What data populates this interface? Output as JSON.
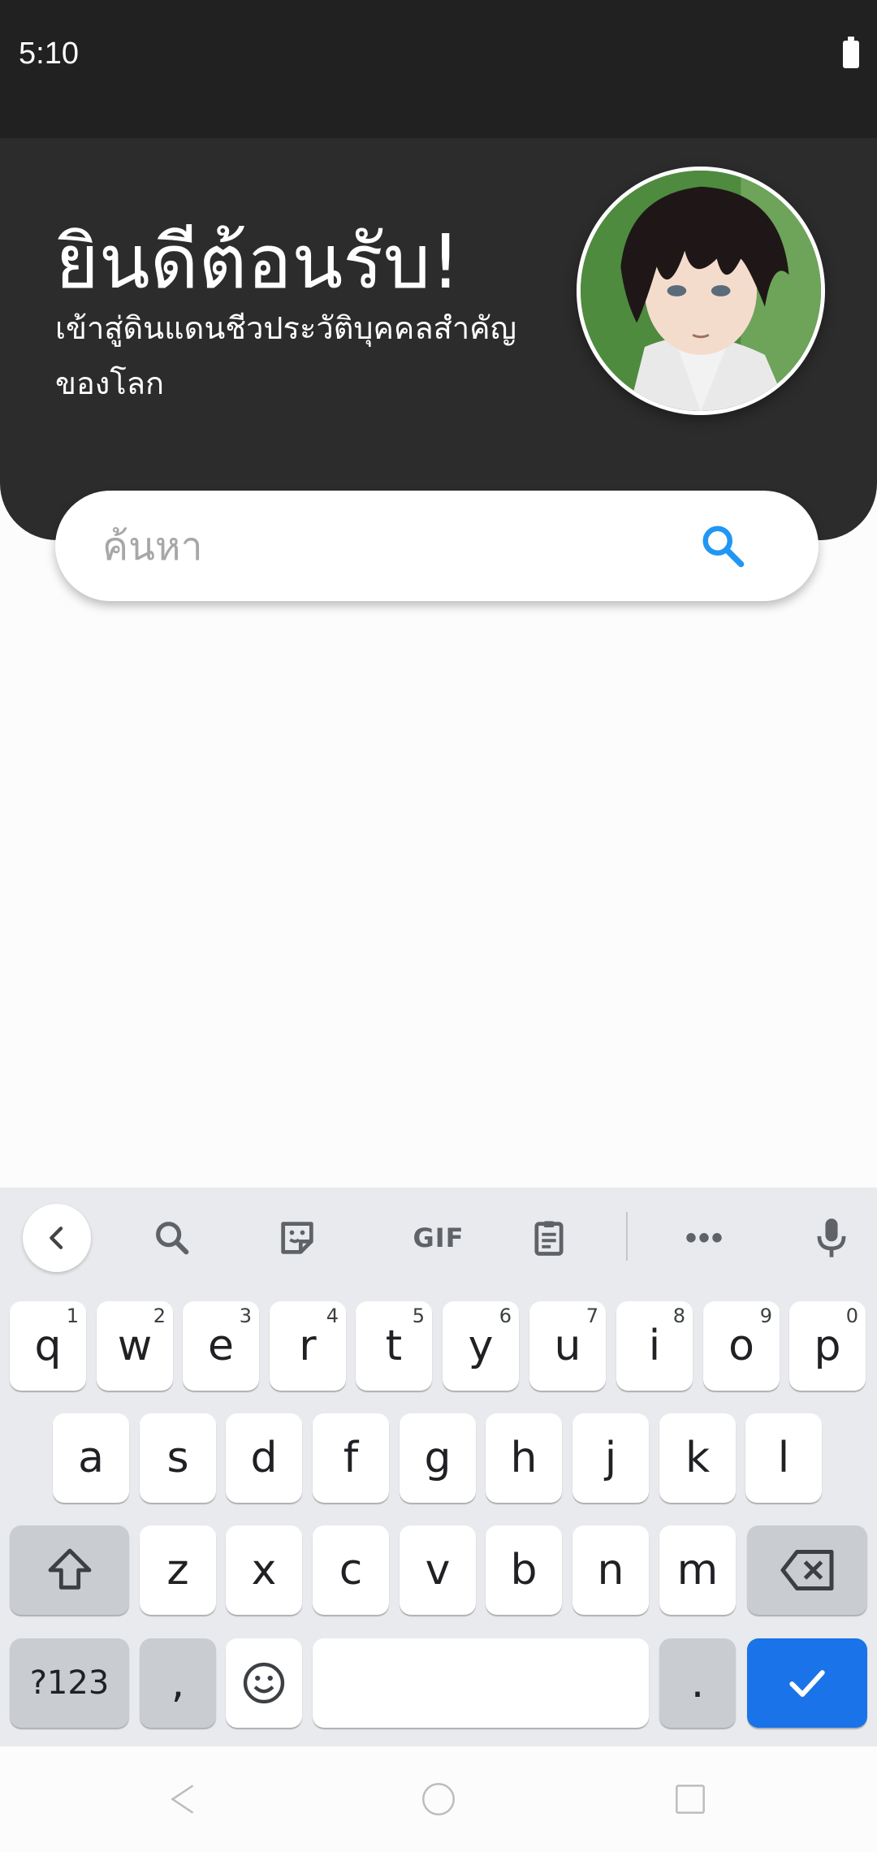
{
  "status_bar": {
    "time": "5:10"
  },
  "header": {
    "title": "ยินดีต้อนรับ!",
    "subtitle": "เข้าสู่ดินแดนชีวประวัติบุคคลสำคัญของโลก"
  },
  "search": {
    "placeholder": "ค้นหา",
    "value": ""
  },
  "keyboard": {
    "toolbar": {
      "gif_label": "GIF",
      "more_label": "•••"
    },
    "row1": [
      {
        "label": "q",
        "hint": "1"
      },
      {
        "label": "w",
        "hint": "2"
      },
      {
        "label": "e",
        "hint": "3"
      },
      {
        "label": "r",
        "hint": "4"
      },
      {
        "label": "t",
        "hint": "5"
      },
      {
        "label": "y",
        "hint": "6"
      },
      {
        "label": "u",
        "hint": "7"
      },
      {
        "label": "i",
        "hint": "8"
      },
      {
        "label": "o",
        "hint": "9"
      },
      {
        "label": "p",
        "hint": "0"
      }
    ],
    "row2": [
      "a",
      "s",
      "d",
      "f",
      "g",
      "h",
      "j",
      "k",
      "l"
    ],
    "row3": [
      "z",
      "x",
      "c",
      "v",
      "b",
      "n",
      "m"
    ],
    "row4": {
      "symbols_label": "?123",
      "comma_label": ",",
      "period_label": "."
    },
    "accent_color": "#1a73e8"
  },
  "colors": {
    "header_bg": "#2c2c2c",
    "status_bg": "#212121",
    "search_icon": "#2196f3"
  }
}
